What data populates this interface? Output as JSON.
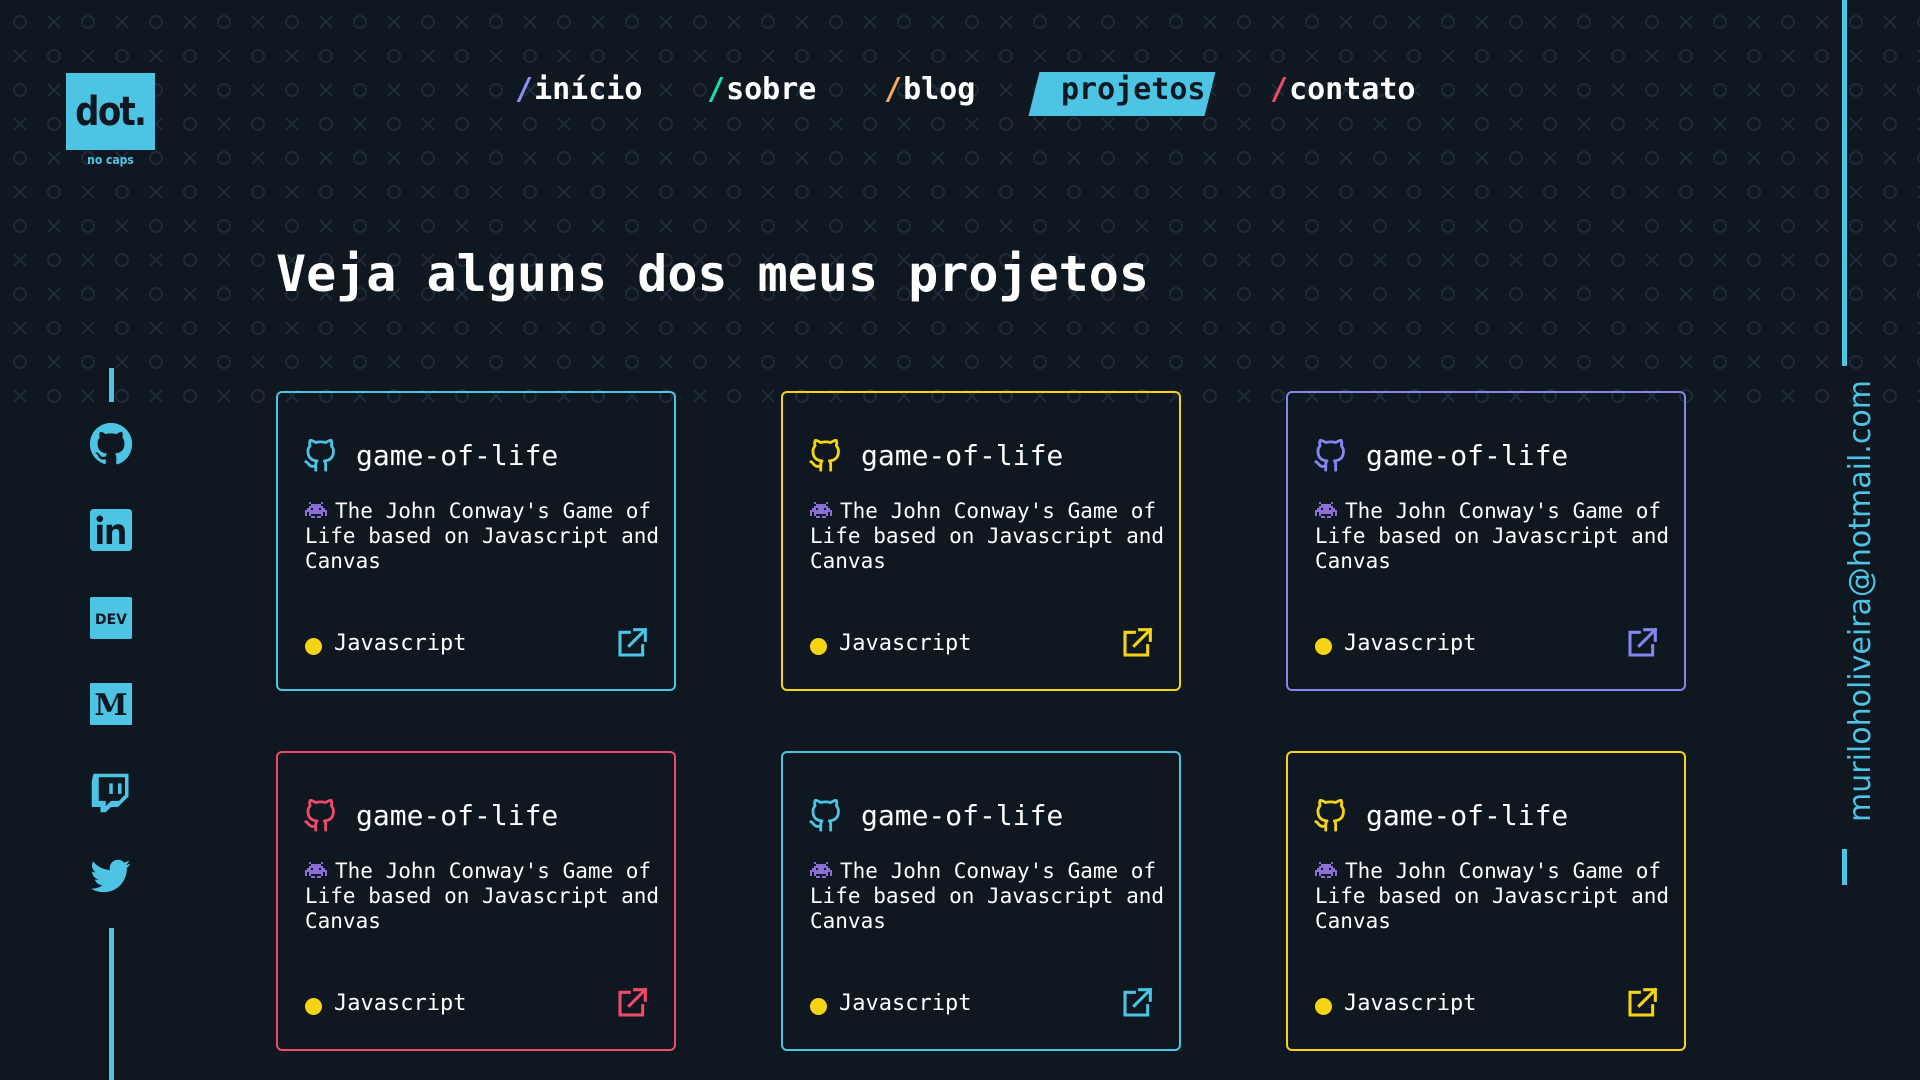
{
  "logo": {
    "text": "dot.",
    "subtitle": "no caps"
  },
  "nav": [
    {
      "slash": "/",
      "label": "início",
      "slash_color": "#8f8ffb",
      "active": false
    },
    {
      "slash": "/",
      "label": "sobre",
      "slash_color": "#16e0b2",
      "active": false
    },
    {
      "slash": "/",
      "label": "blog",
      "slash_color": "#f6a85e",
      "active": false
    },
    {
      "slash": "",
      "label": "projetos",
      "slash_color": "#0f1720",
      "active": true
    },
    {
      "slash": "/",
      "label": "contato",
      "slash_color": "#f04a6a",
      "active": false
    }
  ],
  "page": {
    "title": "Veja alguns dos meus projetos"
  },
  "social": {
    "icons": [
      "github-icon",
      "linkedin-icon",
      "dev-icon",
      "medium-icon",
      "twitch-icon",
      "twitter-icon"
    ]
  },
  "contact": {
    "email": "muriloholiveira@hotmail.com"
  },
  "projects": [
    {
      "name": "game-of-life",
      "description": "The John Conway's Game of Life based on Javascript and Canvas",
      "language": "Javascript",
      "accent": "#4dc4e4"
    },
    {
      "name": "game-of-life",
      "description": "The John Conway's Game of Life based on Javascript and Canvas",
      "language": "Javascript",
      "accent": "#f5d416"
    },
    {
      "name": "game-of-life",
      "description": "The John Conway's Game of Life based on Javascript and Canvas",
      "language": "Javascript",
      "accent": "#8585f0"
    },
    {
      "name": "game-of-life",
      "description": "The John Conway's Game of Life based on Javascript and Canvas",
      "language": "Javascript",
      "accent": "#f04a6a"
    },
    {
      "name": "game-of-life",
      "description": "The John Conway's Game of Life based on Javascript and Canvas",
      "language": "Javascript",
      "accent": "#4dc4e4"
    },
    {
      "name": "game-of-life",
      "description": "The John Conway's Game of Life based on Javascript and Canvas",
      "language": "Javascript",
      "accent": "#f5d416"
    }
  ],
  "colors": {
    "background": "#0f1720",
    "accent": "#4dc4e4",
    "language_dot": "#f5d416",
    "pattern": "#1f2b38"
  }
}
